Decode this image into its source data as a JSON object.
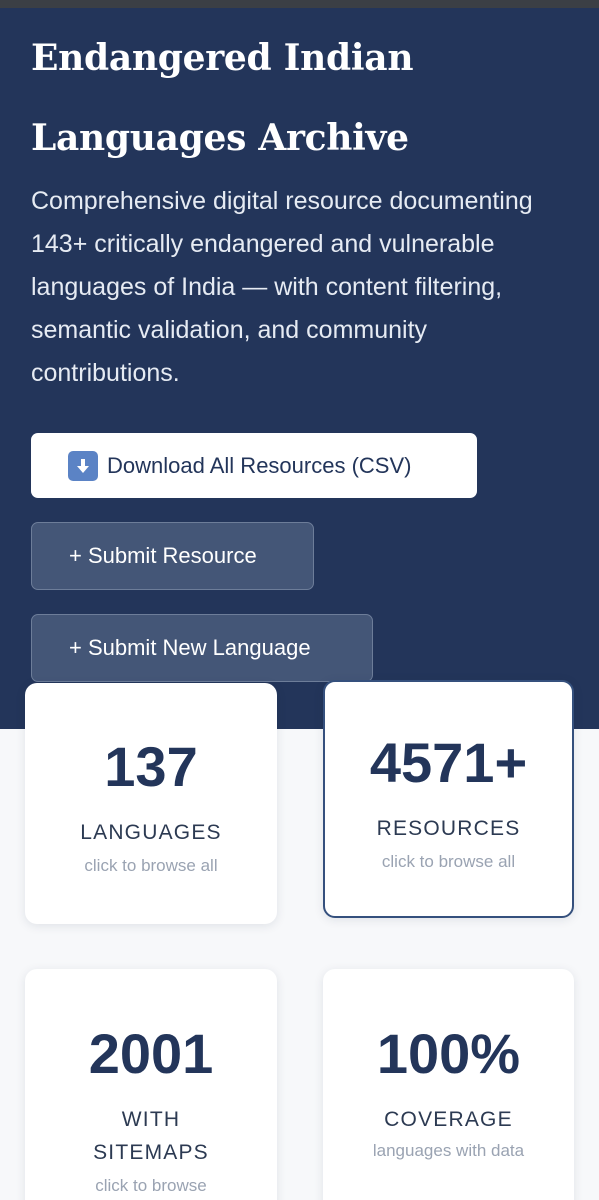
{
  "hero": {
    "title": "Endangered Indian Languages Archive",
    "subtitle": "Comprehensive digital resource documenting 143+ critically endangered and vulnerable languages of India — with content filtering, semantic validation, and community contributions."
  },
  "actions": {
    "download_label": "Download All Resources (CSV)",
    "download_icon": "download-arrow-icon",
    "submit_resource_label": "+ Submit Resource",
    "submit_language_label": "+ Submit New Language"
  },
  "stats": [
    {
      "value": "137",
      "label": "LANGUAGES",
      "hint": "click to browse all"
    },
    {
      "value": "4571+",
      "label": "RESOURCES",
      "hint": "click to browse all"
    },
    {
      "value": "2001",
      "label": "WITH SITEMAPS",
      "hint": "click to browse"
    },
    {
      "value": "100%",
      "label": "COVERAGE",
      "hint": "languages with data"
    }
  ],
  "colors": {
    "hero_bg": "#23355a",
    "primary_text": "#23355a",
    "page_bg": "#f7f8fa",
    "icon_accent": "#5b83c5"
  }
}
